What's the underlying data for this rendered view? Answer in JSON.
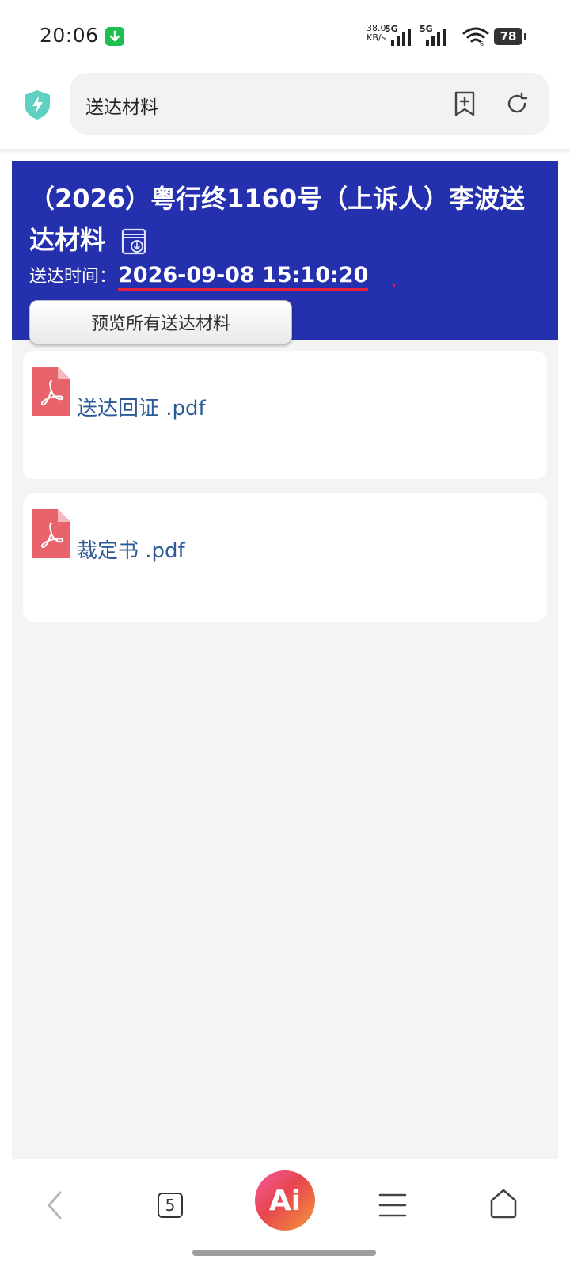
{
  "status_bar": {
    "time": "20:06",
    "net_speed_value": "38.0",
    "net_speed_unit": "KB/s",
    "sim1_label": "5G",
    "sim2_label": "5G",
    "wifi_badge": "6",
    "battery": "78"
  },
  "address_bar": {
    "title": "送达材料"
  },
  "header": {
    "case_title": "（2026）粤行终1160号（上诉人）李波送达材料",
    "time_label": "送达时间：",
    "time_value": "2026-09-08 15:10:20",
    "preview_all_label": "预览所有送达材料"
  },
  "files": [
    {
      "name": "送达回证 .pdf"
    },
    {
      "name": "裁定书 .pdf"
    }
  ],
  "bottom_nav": {
    "tab_count": "5",
    "ai_label": "Ai"
  },
  "colors": {
    "header_bg": "#2430ad",
    "link_text": "#2c5a96",
    "pdf_icon": "#e8636b",
    "underline": "#e8223c"
  }
}
